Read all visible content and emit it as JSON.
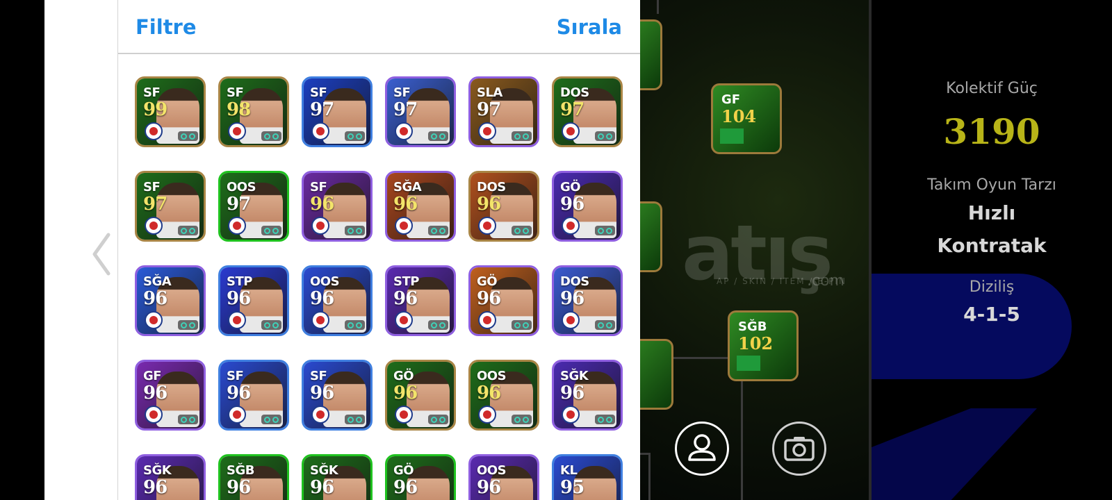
{
  "header": {
    "filter_label": "Filtre",
    "sort_label": "Sırala"
  },
  "cards": [
    {
      "pos": "SF",
      "ovr": "99",
      "frame": "#a98545",
      "bg": "#1e6d1a",
      "ovr_color": "#f3e46a"
    },
    {
      "pos": "SF",
      "ovr": "98",
      "frame": "#a98545",
      "bg": "#1e6d1a",
      "ovr_color": "#f3e46a"
    },
    {
      "pos": "SF",
      "ovr": "97",
      "frame": "#3f7fe0",
      "bg": "#1c3fc0",
      "ovr_color": "#ffffff"
    },
    {
      "pos": "SF",
      "ovr": "97",
      "frame": "#8f5fe0",
      "bg": "#3a5fd0",
      "ovr_color": "#ffffff"
    },
    {
      "pos": "SLA",
      "ovr": "97",
      "frame": "#8f5fe0",
      "bg": "#8a5a1e",
      "ovr_color": "#ffffff"
    },
    {
      "pos": "DOS",
      "ovr": "97",
      "frame": "#a98545",
      "bg": "#1e6d1a",
      "ovr_color": "#f3e46a"
    },
    {
      "pos": "SF",
      "ovr": "97",
      "frame": "#a98545",
      "bg": "#1e6d1a",
      "ovr_color": "#f3e46a"
    },
    {
      "pos": "OOS",
      "ovr": "97",
      "frame": "#1fc21f",
      "bg": "#1e6d1a",
      "ovr_color": "#ffffff"
    },
    {
      "pos": "SF",
      "ovr": "96",
      "frame": "#8f5fe0",
      "bg": "#6a2aa0",
      "ovr_color": "#f3e46a"
    },
    {
      "pos": "SĞA",
      "ovr": "96",
      "frame": "#8f5fe0",
      "bg": "#a8461e",
      "ovr_color": "#f3e46a"
    },
    {
      "pos": "DOS",
      "ovr": "96",
      "frame": "#a98545",
      "bg": "#b0501e",
      "ovr_color": "#f3e46a"
    },
    {
      "pos": "GÖ",
      "ovr": "96",
      "frame": "#8f5fe0",
      "bg": "#4a2ab0",
      "ovr_color": "#ffffff"
    },
    {
      "pos": "SĞA",
      "ovr": "96",
      "frame": "#8f5fe0",
      "bg": "#2a5ad8",
      "ovr_color": "#ffffff"
    },
    {
      "pos": "STP",
      "ovr": "96",
      "frame": "#3f7fe0",
      "bg": "#2a3ad0",
      "ovr_color": "#ffffff"
    },
    {
      "pos": "OOS",
      "ovr": "96",
      "frame": "#3f7fe0",
      "bg": "#2a4ad0",
      "ovr_color": "#ffffff"
    },
    {
      "pos": "STP",
      "ovr": "96",
      "frame": "#8f5fe0",
      "bg": "#5a2ab0",
      "ovr_color": "#ffffff"
    },
    {
      "pos": "GÖ",
      "ovr": "96",
      "frame": "#8f5fe0",
      "bg": "#c0601e",
      "ovr_color": "#ffffff"
    },
    {
      "pos": "DOS",
      "ovr": "96",
      "frame": "#8f5fe0",
      "bg": "#3a5ad0",
      "ovr_color": "#ffffff"
    },
    {
      "pos": "GF",
      "ovr": "96",
      "frame": "#8f5fe0",
      "bg": "#7a2ab0",
      "ovr_color": "#ffffff"
    },
    {
      "pos": "SF",
      "ovr": "96",
      "frame": "#3f7fe0",
      "bg": "#2a4ad0",
      "ovr_color": "#ffffff"
    },
    {
      "pos": "SF",
      "ovr": "96",
      "frame": "#3f7fe0",
      "bg": "#2a4ad0",
      "ovr_color": "#ffffff"
    },
    {
      "pos": "GÖ",
      "ovr": "96",
      "frame": "#a98545",
      "bg": "#1e6d1a",
      "ovr_color": "#f3e46a"
    },
    {
      "pos": "OOS",
      "ovr": "96",
      "frame": "#a98545",
      "bg": "#1e6d1a",
      "ovr_color": "#f3e46a"
    },
    {
      "pos": "SĞK",
      "ovr": "96",
      "frame": "#8f5fe0",
      "bg": "#4a2ab0",
      "ovr_color": "#ffffff"
    },
    {
      "pos": "SĞK",
      "ovr": "96",
      "frame": "#8f5fe0",
      "bg": "#5a2ab0",
      "ovr_color": "#ffffff"
    },
    {
      "pos": "SĞB",
      "ovr": "96",
      "frame": "#1fc21f",
      "bg": "#1e6d1a",
      "ovr_color": "#ffffff"
    },
    {
      "pos": "SĞK",
      "ovr": "96",
      "frame": "#1fc21f",
      "bg": "#1e6d1a",
      "ovr_color": "#ffffff"
    },
    {
      "pos": "GÖ",
      "ovr": "96",
      "frame": "#1fc21f",
      "bg": "#1e6d1a",
      "ovr_color": "#ffffff"
    },
    {
      "pos": "OOS",
      "ovr": "96",
      "frame": "#8f5fe0",
      "bg": "#5a2ab0",
      "ovr_color": "#ffffff"
    },
    {
      "pos": "KL",
      "ovr": "95",
      "frame": "#3f7fe0",
      "bg": "#2a4ad0",
      "ovr_color": "#ffffff"
    }
  ],
  "pitch_cards": [
    {
      "pos": "GF",
      "ovr": "104"
    },
    {
      "pos": "SĞB",
      "ovr": "102"
    }
  ],
  "stats": {
    "collective_label": "Kolektif Güç",
    "collective_value": "3190",
    "style_label": "Takım Oyun Tarzı",
    "style_value_1": "Hızlı",
    "style_value_2": "Kontratak",
    "formation_label": "Diziliş",
    "formation_value": "4-1-5"
  },
  "watermark": {
    "text": "atış",
    "sub": "AP / SKIN / ITEM / E-PIN",
    "com": ".com"
  },
  "icons": [
    "back-chevron-icon",
    "profile-icon",
    "camera-icon"
  ]
}
